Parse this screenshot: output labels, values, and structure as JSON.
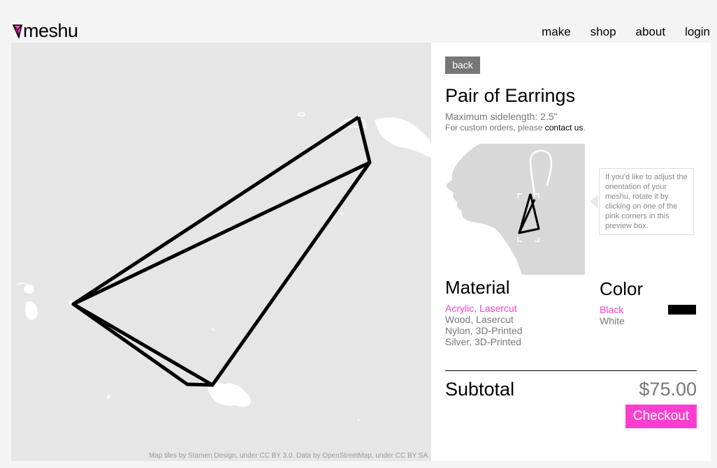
{
  "header": {
    "logo_text": "meshu",
    "nav": [
      "make",
      "shop",
      "about",
      "login"
    ]
  },
  "map": {
    "credit": "Map tiles by Stamen Design, under CC BY 3.0. Data by OpenStreetMap, under CC BY SA."
  },
  "panel": {
    "back_label": "back",
    "title": "Pair of Earrings",
    "max_sidelength": "Maximum sidelength: 2.5\"",
    "custom_prefix": "For custom orders, please",
    "custom_link": "contact us",
    "custom_suffix": ".",
    "tooltip": "If you'd like to adjust the orientation of your meshu, rotate it by clicking on one of the pink corners in this preview box.",
    "material_title": "Material",
    "materials": [
      "Acrylic, Lasercut",
      "Wood, Lasercut",
      "Nylon, 3D-Printed",
      "Silver, 3D-Printed"
    ],
    "color_title": "Color",
    "colors": [
      "Black",
      "White"
    ],
    "subtotal_label": "Subtotal",
    "subtotal_value": "$75.00",
    "checkout_label": "Checkout"
  },
  "colors": {
    "accent": "#ff3ecf",
    "map_bg": "#e6e6e6",
    "button_gray": "#777777"
  }
}
